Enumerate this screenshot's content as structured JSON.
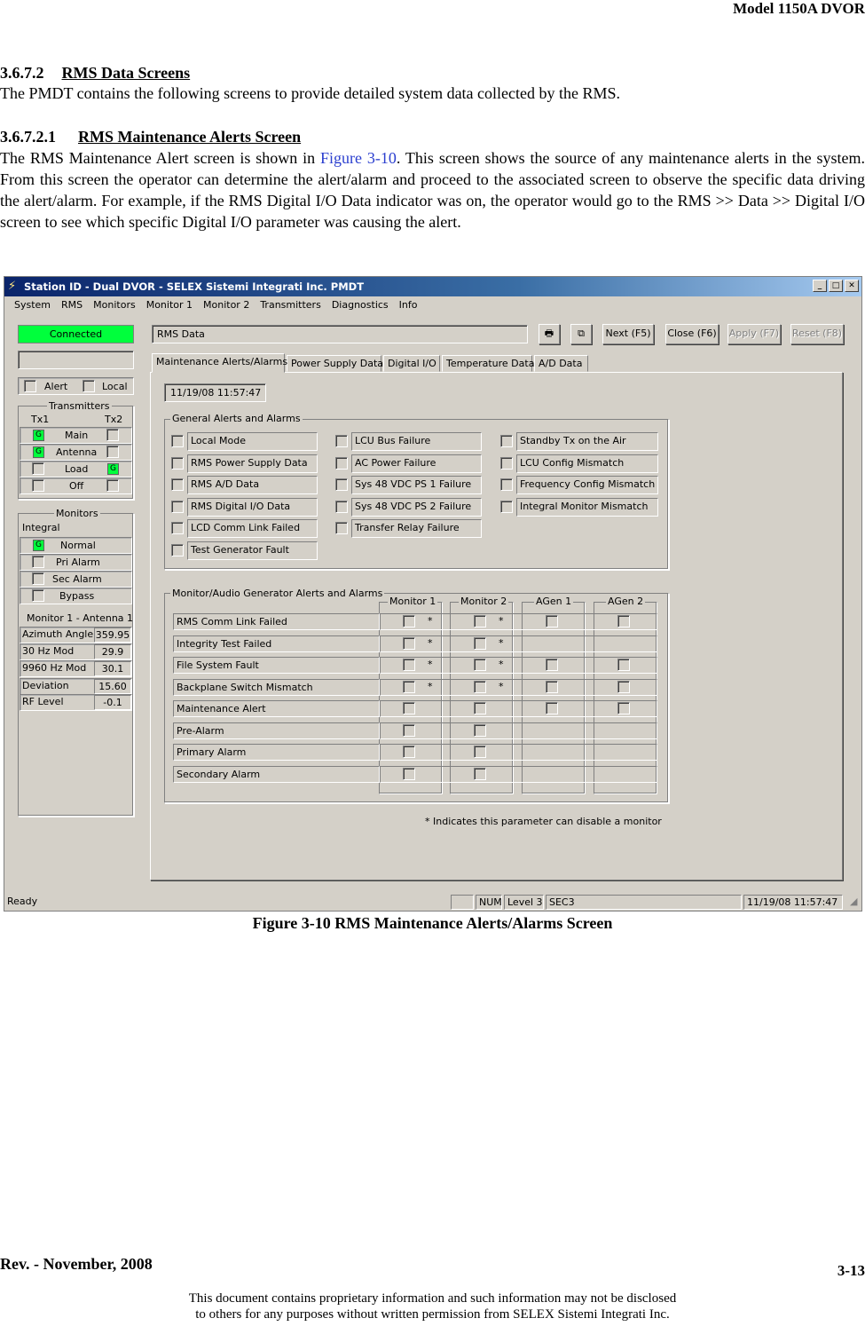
{
  "doc": {
    "header": "Model 1150A DVOR",
    "s1_num": "3.6.7.2",
    "s1_title": "RMS Data Screens",
    "s1_text": "The PMDT contains the following screens to provide detailed system data collected by the RMS.",
    "s2_num": "3.6.7.2.1",
    "s2_title": "RMS Maintenance Alerts Screen",
    "s2_text_a": "The RMS Maintenance Alert screen is shown in ",
    "s2_figref": "Figure 3-10",
    "s2_text_b": ". This screen shows the source of any maintenance alerts in the system.  From this screen the operator can determine the alert/alarm and proceed to the associated screen to observe the specific data driving the alert/alarm. For example, if the RMS Digital I/O Data indicator was on, the operator would go to the RMS >> Data >> Digital I/O screen to see which specific Digital I/O parameter was causing the alert.",
    "caption": "Figure 3-10  RMS Maintenance Alerts/Alarms Screen",
    "footer_rev": "Rev. -  November, 2008",
    "footer_page": "3-13",
    "footer_notice_1": "This document contains proprietary information and such information may not be disclosed",
    "footer_notice_2": "to others for any purposes without written permission from SELEX Sistemi Integrati Inc."
  },
  "app": {
    "title": "Station ID - Dual DVOR - SELEX Sistemi Integrati Inc. PMDT",
    "menu": [
      "System",
      "RMS",
      "Monitors",
      "Monitor 1",
      "Monitor 2",
      "Transmitters",
      "Diagnostics",
      "Info"
    ],
    "connection_status": "Connected",
    "screen_name": "RMS Data",
    "buttons": {
      "next": "Next (F5)",
      "close": "Close (F6)",
      "apply": "Apply (F7)",
      "reset": "Reset (F8)"
    },
    "status_left": {
      "alert": "Alert",
      "local": "Local"
    },
    "transmitters": {
      "title": "Transmitters",
      "tx1": "Tx1",
      "tx2": "Tx2",
      "rows": [
        "Main",
        "Antenna",
        "Load",
        "Off"
      ],
      "led_label": "G"
    },
    "monitors": {
      "title": "Monitors",
      "integral": "Integral",
      "rows": [
        "Normal",
        "Pri Alarm",
        "Sec Alarm",
        "Bypass"
      ],
      "subtitle": "Monitor 1 - Antenna 1",
      "readings": [
        {
          "label": "Azimuth Angle",
          "value": "359.95"
        },
        {
          "label": "30 Hz Mod",
          "value": "29.9"
        },
        {
          "label": "9960 Hz Mod",
          "value": "30.1"
        },
        {
          "label": "Deviation",
          "value": "15.60"
        },
        {
          "label": "RF Level",
          "value": "-0.1"
        }
      ]
    },
    "tabs": [
      "Maintenance Alerts/Alarms",
      "Power Supply Data",
      "Digital I/O",
      "Temperature Data",
      "A/D Data"
    ],
    "timestamp": "11/19/08 11:57:47",
    "general_alerts": {
      "title": "General Alerts and Alarms",
      "col1": [
        "Local Mode",
        "RMS Power Supply Data",
        "RMS A/D Data",
        "RMS Digital I/O Data",
        "LCD Comm Link Failed",
        "Test Generator Fault"
      ],
      "col2": [
        "LCU Bus Failure",
        "AC Power Failure",
        "Sys 48 VDC PS 1 Failure",
        "Sys 48 VDC PS 2 Failure",
        "Transfer Relay Failure"
      ],
      "col3": [
        "Standby Tx on the Air",
        "LCU Config Mismatch",
        "Frequency Config Mismatch",
        "Integral Monitor Mismatch"
      ]
    },
    "monitor_alerts": {
      "title": "Monitor/Audio Generator Alerts and Alarms",
      "columns": [
        "Monitor 1",
        "Monitor 2",
        "AGen 1",
        "AGen 2"
      ],
      "rows": [
        "RMS Comm Link Failed",
        "Integrity Test Failed",
        "File System Fault",
        "Backplane Switch Mismatch",
        "Maintenance Alert",
        "Pre-Alarm",
        "Primary Alarm",
        "Secondary Alarm"
      ],
      "star": "*",
      "note": "* Indicates this parameter can disable a monitor"
    },
    "statusbar": {
      "ready": "Ready",
      "num": "NUM",
      "level": "Level 3",
      "user": "SEC3",
      "time": "11/19/08 11:57:47"
    }
  }
}
